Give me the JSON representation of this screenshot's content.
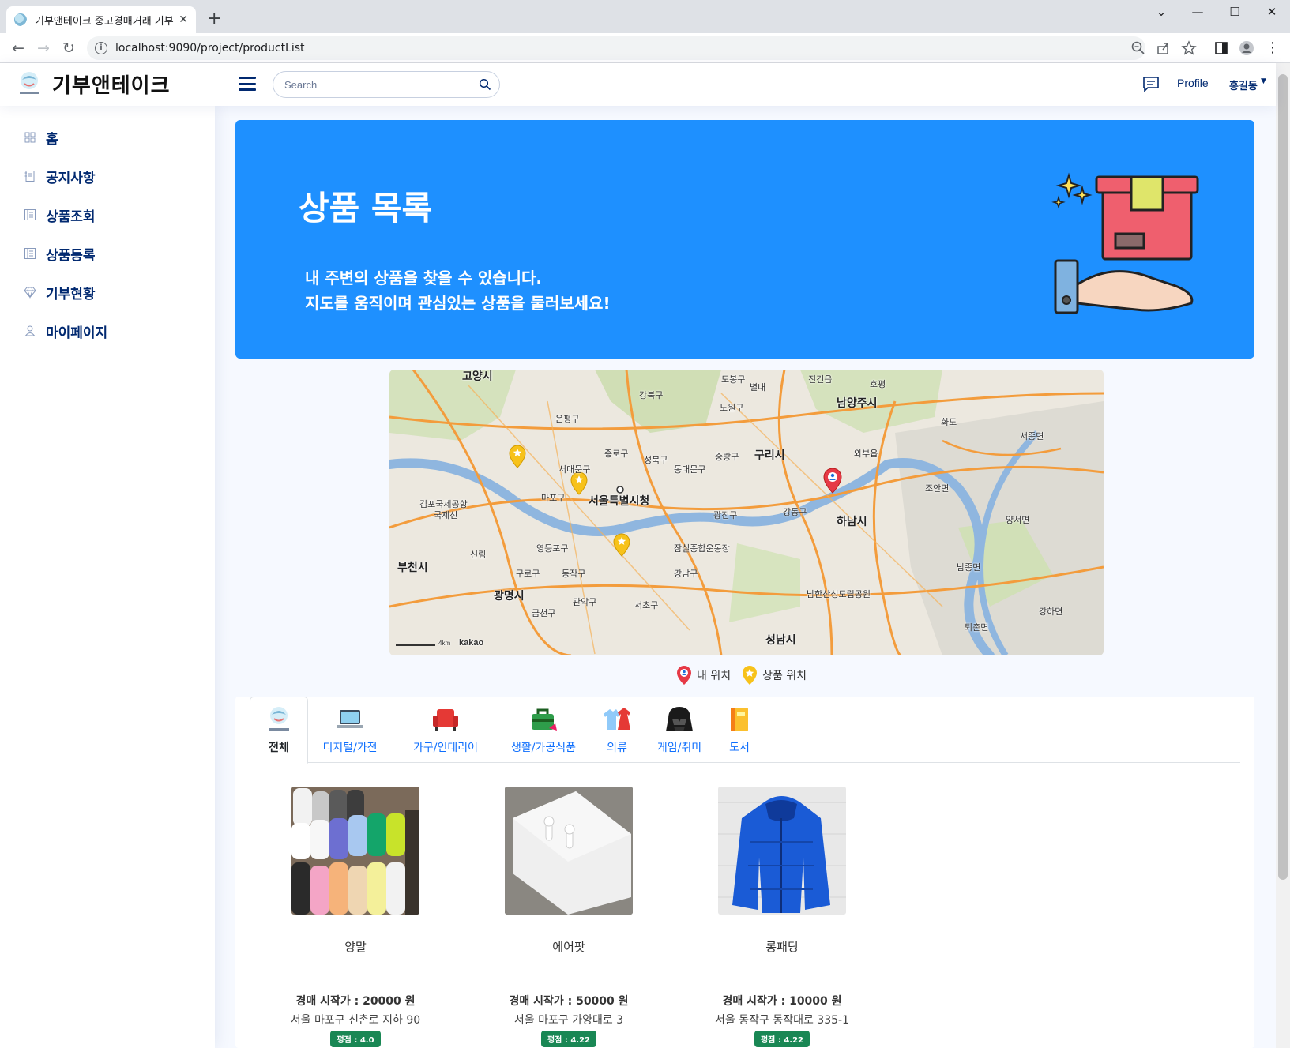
{
  "browser": {
    "tab_title": "기부앤테이크 중고경매거래 기부",
    "url": "localhost:9090/project/productList"
  },
  "header": {
    "logo_text": "기부앤테이크",
    "search_placeholder": "Search",
    "profile_alt": "Profile",
    "user_name": "홍길동"
  },
  "sidebar": {
    "items": [
      {
        "label": "홈",
        "icon": "grid-icon"
      },
      {
        "label": "공지사항",
        "icon": "journal-icon"
      },
      {
        "label": "상품조회",
        "icon": "layout-text-icon"
      },
      {
        "label": "상품등록",
        "icon": "layout-text-icon"
      },
      {
        "label": "기부현황",
        "icon": "gem-icon"
      },
      {
        "label": "마이페이지",
        "icon": "person-icon"
      }
    ]
  },
  "hero": {
    "title": "상품 목록",
    "line1": "내 주변의 상품을 찾을 수 있습니다.",
    "line2": "지도를 움직이며 관심있는 상품을 둘러보세요!"
  },
  "map": {
    "labels": [
      "고양시",
      "강북구",
      "도봉구",
      "노원구",
      "별내",
      "진건읍",
      "호평",
      "남양주시",
      "은평구",
      "종로구",
      "성북구",
      "중랑구",
      "구리시",
      "서대문구",
      "동대문구",
      "서울특별시청",
      "마포구",
      "김포국제공항",
      "국제선",
      "강동구",
      "하남시",
      "영등포구",
      "동작구",
      "광진구",
      "잠실종합운동장",
      "강남구",
      "구로구",
      "광명시",
      "부천시",
      "금천구",
      "관악구",
      "서초구",
      "성남시",
      "남한산성도립공원",
      "조안면",
      "양서면",
      "서종면",
      "강하면",
      "퇴촌면",
      "남종면",
      "화도",
      "와부읍",
      "신림",
      "kakao",
      "4km"
    ]
  },
  "legend": {
    "my_location": "내 위치",
    "product_location": "상품 위치"
  },
  "categories": [
    {
      "label": "전체",
      "icon": "donation-logo-icon"
    },
    {
      "label": "디지털/가전",
      "icon": "laptop-icon"
    },
    {
      "label": "가구/인테리어",
      "icon": "sofa-icon"
    },
    {
      "label": "생활/가공식품",
      "icon": "bag-icon"
    },
    {
      "label": "의류",
      "icon": "clothes-icon"
    },
    {
      "label": "게임/취미",
      "icon": "helmet-icon"
    },
    {
      "label": "도서",
      "icon": "book-icon"
    }
  ],
  "products": [
    {
      "name": "양말",
      "price": "경매 시작가 : 20000 원",
      "address": "서울 마포구 신촌로 지하 90",
      "rating": "평점 : 4.0",
      "image": "socks-photo"
    },
    {
      "name": "에어팟",
      "price": "경매 시작가 : 50000 원",
      "address": "서울 마포구 가양대로 3",
      "rating": "평점 : 4.22",
      "image": "airpods-photo"
    },
    {
      "name": "롱패딩",
      "price": "경매 시작가 : 10000 원",
      "address": "서울 동작구 동작대로 335-1",
      "rating": "평점 : 4.22",
      "image": "padding-photo"
    }
  ]
}
